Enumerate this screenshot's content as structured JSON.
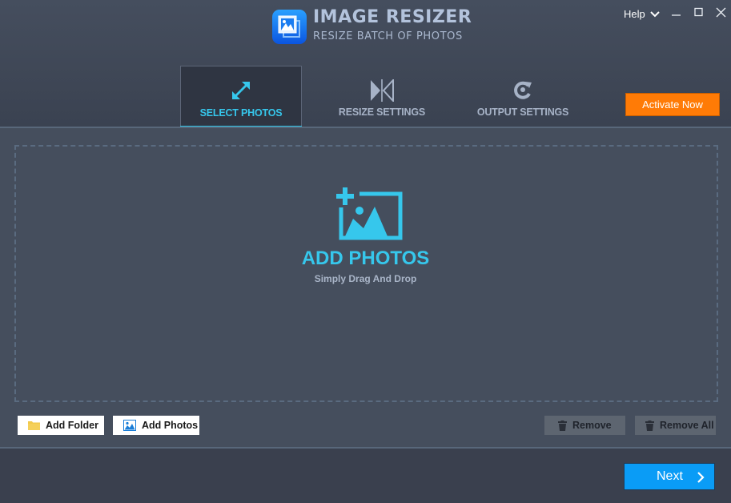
{
  "app": {
    "title": "IMAGE RESIZER",
    "subtitle": "RESIZE BATCH OF PHOTOS",
    "logo_icon": "photo-stack-icon"
  },
  "window": {
    "help_label": "Help",
    "controls": [
      "minimize",
      "maximize",
      "close"
    ]
  },
  "tabs": [
    {
      "label": "SELECT PHOTOS",
      "icon": "expand-arrows-icon",
      "active": true
    },
    {
      "label": "RESIZE SETTINGS",
      "icon": "flip-icon",
      "active": false
    },
    {
      "label": "OUTPUT SETTINGS",
      "icon": "refresh-target-icon",
      "active": false
    }
  ],
  "activate_button": {
    "label": "Activate Now",
    "color": "#ff7b06"
  },
  "dropzone": {
    "title": "ADD PHOTOS",
    "subtitle": "Simply Drag And Drop",
    "icon": "add-photo-icon",
    "accent": "#36c7ec"
  },
  "actions": {
    "add_folder": "Add Folder",
    "add_photos": "Add Photos",
    "remove": "Remove",
    "remove_all": "Remove All"
  },
  "footer": {
    "next_label": "Next",
    "next_color": "#0a9cf6"
  }
}
